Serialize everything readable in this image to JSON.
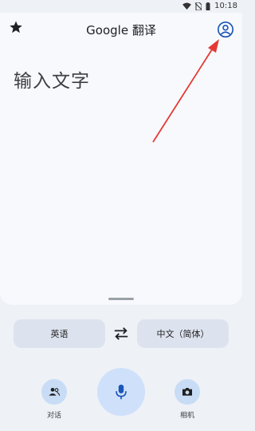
{
  "status_bar": {
    "time": "10:18"
  },
  "app_bar": {
    "title": "Google 翻译"
  },
  "input": {
    "placeholder": "输入文字"
  },
  "languages": {
    "source": "英语",
    "target": "中文（简体）"
  },
  "actions": {
    "conversation_label": "对话",
    "camera_label": "相机"
  },
  "colors": {
    "annotation_arrow": "#e53935",
    "primary_icon": "#1a56b8"
  }
}
